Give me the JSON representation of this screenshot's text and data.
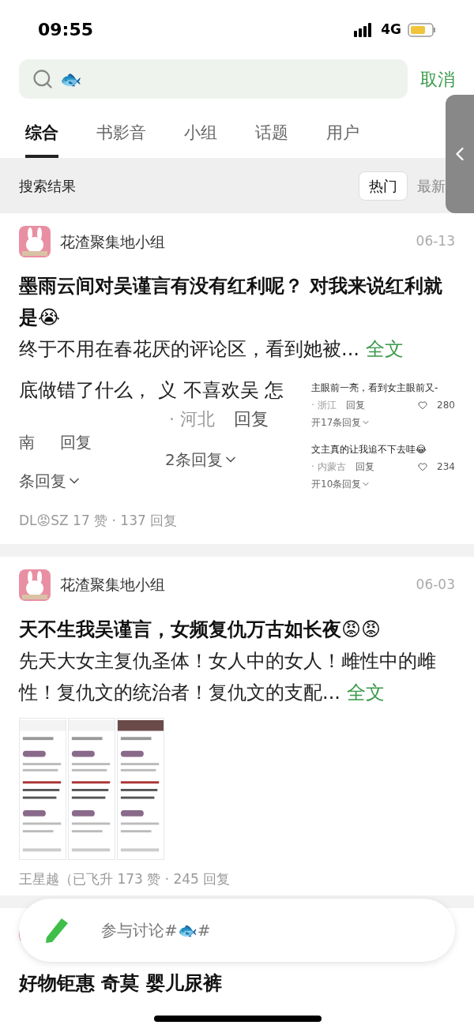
{
  "status_bar": {
    "time": "09:55",
    "network": "4G"
  },
  "search": {
    "query": "🐟",
    "cancel": "取消"
  },
  "tabs": [
    {
      "label": "综合",
      "selected": true
    },
    {
      "label": "书影音",
      "selected": false
    },
    {
      "label": "小组",
      "selected": false
    },
    {
      "label": "话题",
      "selected": false
    },
    {
      "label": "用户",
      "selected": false
    }
  ],
  "results_bar": {
    "title": "搜索结果",
    "sort": [
      {
        "label": "热门",
        "selected": true
      },
      {
        "label": "最新",
        "selected": false
      }
    ]
  },
  "posts": [
    {
      "kind": "fragments",
      "group": "花渣聚集地小组",
      "date": "06-13",
      "title": "墨雨云间对吴谨言有没有红利呢？  对我来说红利就是😭",
      "excerpt": "终于不用在春花厌的评论区，看到她被...",
      "more": "全文",
      "fragments_left": {
        "line": "底做错了什么，",
        "line_2": "义 不喜欢吴 怎",
        "place": "· 河北",
        "reply": "回复",
        "place_2": "南",
        "reply_2": "回复",
        "expand": "2条回复",
        "expand_2": "条回复"
      },
      "fragments_right": [
        {
          "text": "主眼前一亮，看到女主眼前又-",
          "place": "· 浙江",
          "reply": "回复",
          "likes": "280",
          "expand": "开17条回复"
        },
        {
          "text": "文主真的让我追不下去哇😂",
          "place": "· 内蒙古",
          "reply": "回复",
          "likes": "234",
          "expand": "开10条回复"
        }
      ],
      "footer": "DL😡SZ 17 赞 · 137 回复"
    },
    {
      "kind": "images",
      "group": "花渣聚集地小组",
      "date": "06-03",
      "title": "天不生我吴谨言，女频复仇万古如长夜😡😡",
      "excerpt": "先天大女主复仇圣体！女人中的女人！雌性中的雌性！复仇文的统治者！复仇文的支配...",
      "more": "全文",
      "footer": "王星越（已飞升 173 赞 · 245 回复"
    },
    {
      "kind": "ad",
      "title": "好物钜惠 奇莫 婴儿尿裤"
    }
  ],
  "compose": {
    "placeholder": "参与讨论#🐟#"
  }
}
